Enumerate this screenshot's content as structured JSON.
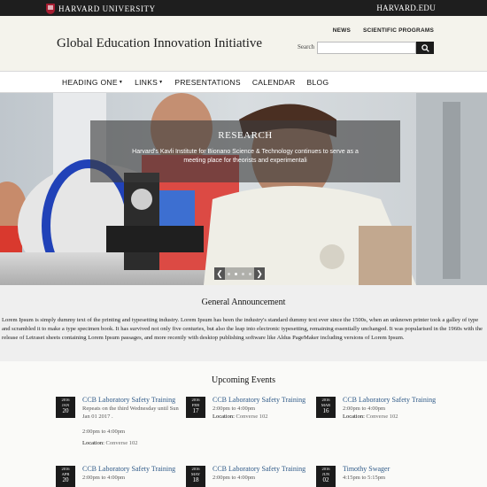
{
  "topbar": {
    "university": "HARVARD UNIVERSITY",
    "link": "HARVARD.EDU"
  },
  "header": {
    "site_title": "Global Education Innovation Initiative",
    "utility_links": [
      "NEWS",
      "SCIENTIFIC PROGRAMS"
    ],
    "search_label": "Search",
    "search_placeholder": ""
  },
  "nav": {
    "items": [
      {
        "label": "HEADING ONE",
        "dropdown": true
      },
      {
        "label": "LINKS",
        "dropdown": true
      },
      {
        "label": "PRESENTATIONS",
        "dropdown": false
      },
      {
        "label": "CALENDAR",
        "dropdown": false
      },
      {
        "label": "BLOG",
        "dropdown": false
      }
    ]
  },
  "hero": {
    "title": "RESEARCH",
    "text": "Harvard's Kavli Institute for Bionano Science & Technology continues to serve as a meeting place for theorists and experimentali",
    "prev": "❮",
    "next": "❯",
    "slides": 4,
    "active_slide": 1
  },
  "announcement": {
    "heading": "General Announcement",
    "body": "Lorem Ipsum is simply dummy text of the printing and typesetting industry. Lorem Ipsum has been the industry's standard dummy text ever since the 1500s, when an unknown printer took a galley of type and scrambled it to make a type specimen book. It has survived not only five centuries, but also the leap into electronic typesetting, remaining essentially unchanged. It was popularised in the 1960s with the release of Letraset sheets containing Lorem Ipsum passages, and more recently with desktop publishing software like Aldus PageMaker including versions of Lorem Ipsum."
  },
  "events": {
    "heading": "Upcoming Events",
    "items": [
      {
        "year": "2016",
        "month": "JAN",
        "day": "20",
        "title": "CCB Laboratory Safety Training",
        "meta": "Repeats on the third Wednesday until Sun Jan 01 2017 .",
        "time": "2:00pm to 4:00pm",
        "loc_label": "Location:",
        "loc": "Converse 102"
      },
      {
        "year": "2016",
        "month": "FEB",
        "day": "17",
        "title": "CCB Laboratory Safety Training",
        "meta": "",
        "time": "2:00pm to 4:00pm",
        "loc_label": "Location:",
        "loc": "Converse 102"
      },
      {
        "year": "2016",
        "month": "MAR",
        "day": "16",
        "title": "CCB Laboratory Safety Training",
        "meta": "",
        "time": "2:00pm to 4:00pm",
        "loc_label": "Location:",
        "loc": "Converse 102"
      },
      {
        "year": "2016",
        "month": "APR",
        "day": "20",
        "title": "CCB Laboratory Safety Training",
        "meta": "",
        "time": "2:00pm to 4:00pm",
        "loc_label": "",
        "loc": ""
      },
      {
        "year": "2016",
        "month": "MAY",
        "day": "18",
        "title": "CCB Laboratory Safety Training",
        "meta": "",
        "time": "2:00pm to 4:00pm",
        "loc_label": "",
        "loc": ""
      },
      {
        "year": "2016",
        "month": "JUN",
        "day": "02",
        "title": "Timothy Swager",
        "meta": "",
        "time": "4:15pm to 5:15pm",
        "loc_label": "",
        "loc": ""
      }
    ]
  },
  "colors": {
    "topbar": "#1e1e1e",
    "link": "#2f5a88",
    "crimson": "#a51c30"
  }
}
